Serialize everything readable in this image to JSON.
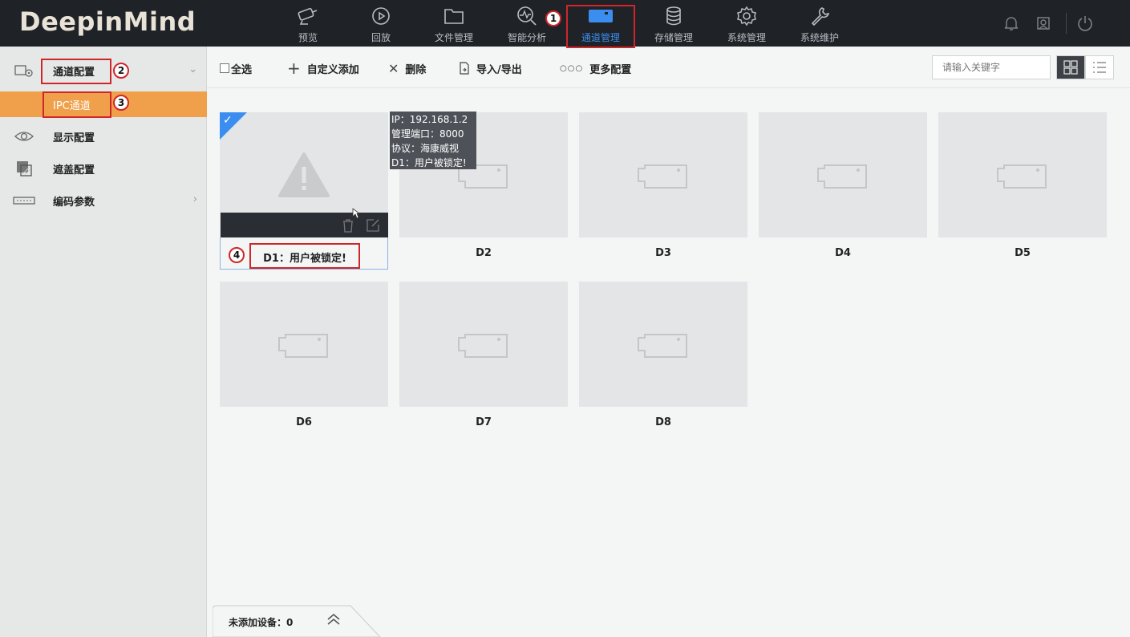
{
  "app": {
    "logo": "DeepinMind"
  },
  "nav": {
    "items": [
      {
        "label": "预览",
        "icon": "camera-icon"
      },
      {
        "label": "回放",
        "icon": "playback-icon"
      },
      {
        "label": "文件管理",
        "icon": "folder-icon"
      },
      {
        "label": "智能分析",
        "icon": "analysis-icon"
      },
      {
        "label": "通道管理",
        "icon": "channel-icon",
        "active": true
      },
      {
        "label": "存储管理",
        "icon": "database-icon"
      },
      {
        "label": "系统管理",
        "icon": "gear-icon"
      },
      {
        "label": "系统维护",
        "icon": "wrench-icon"
      }
    ],
    "active_color": "#3b8ef0"
  },
  "sidebar": {
    "items": [
      {
        "label": "通道配置",
        "icon": "channel-config-icon",
        "arrow": "⌄"
      },
      {
        "label": "IPC通道",
        "sub": true
      },
      {
        "label": "显示配置",
        "icon": "eye-icon"
      },
      {
        "label": "遮盖配置",
        "icon": "mask-icon"
      },
      {
        "label": "编码参数",
        "icon": "encode-icon",
        "arrow": "›"
      }
    ],
    "active_color": "#f0a04a"
  },
  "toolbar": {
    "select_all": "全选",
    "add": "自定义添加",
    "delete": "删除",
    "import_export": "导入/导出",
    "more": "更多配置",
    "search_placeholder": "请输入关键字"
  },
  "channels": [
    {
      "name": "D1：用户被锁定!",
      "status": "warning"
    },
    {
      "name": "D2"
    },
    {
      "name": "D3"
    },
    {
      "name": "D4"
    },
    {
      "name": "D5"
    },
    {
      "name": "D6"
    },
    {
      "name": "D7"
    },
    {
      "name": "D8"
    }
  ],
  "tooltip": {
    "ip": "IP：192.168.1.2",
    "port": "管理端口：8000",
    "protocol": "协议：海康威视",
    "status": "D1：用户被锁定!"
  },
  "bottom": {
    "label": "未添加设备：0"
  },
  "annotations": [
    "1",
    "2",
    "3",
    "4"
  ]
}
